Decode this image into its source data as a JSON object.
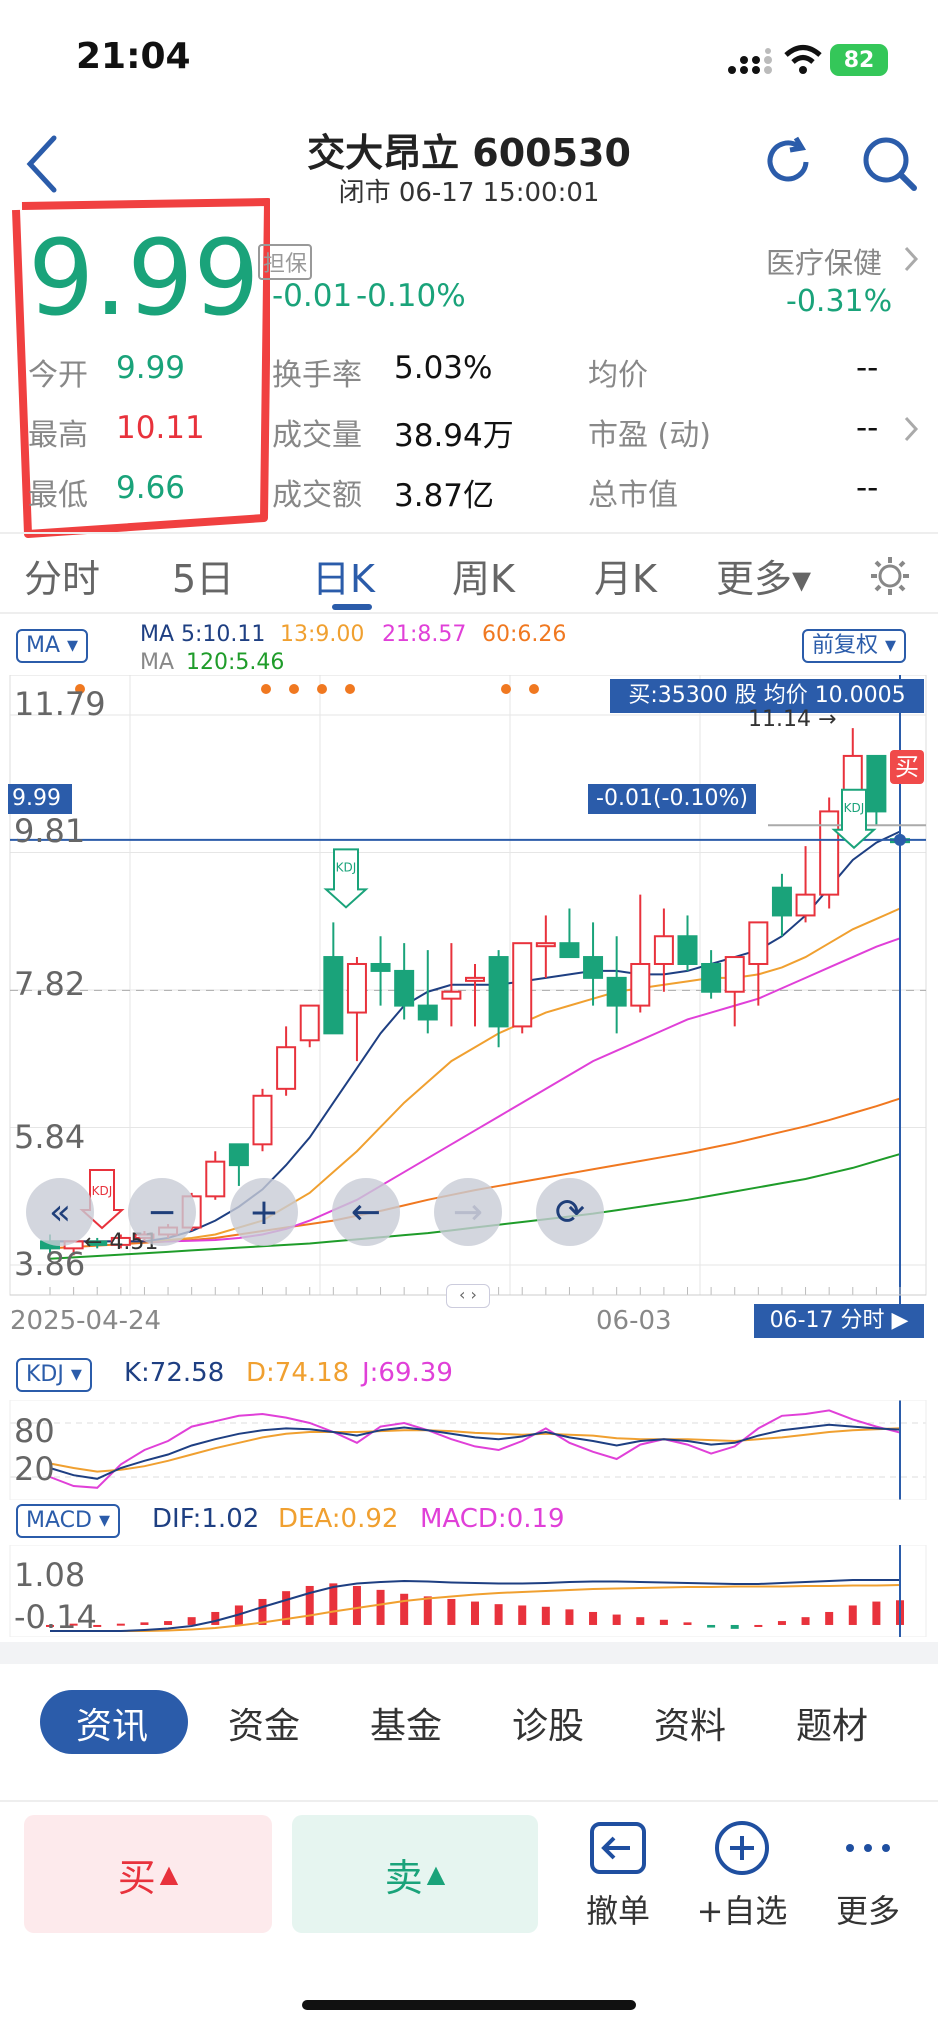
{
  "status_bar": {
    "time": "21:04",
    "battery": "82"
  },
  "header": {
    "title": "交大昂立 600530",
    "subtitle": "闭市 06-17 15:00:01"
  },
  "quote": {
    "price": "9.99",
    "margin_tag": "担保",
    "change": "-0.01",
    "change_pct": "-0.10%",
    "sector": "医疗保健",
    "sector_pct": "-0.31%",
    "open_label": "今开",
    "open": "9.99",
    "high_label": "最高",
    "high": "10.11",
    "low_label": "最低",
    "low": "9.66",
    "turnover_label": "换手率",
    "turnover": "5.03%",
    "volume_label": "成交量",
    "volume": "38.94万",
    "amount_label": "成交额",
    "amount": "3.87亿",
    "avg_label": "均价",
    "avg": "--",
    "pe_label": "市盈 (动)",
    "pe": "--",
    "mcap_label": "总市值",
    "mcap": "--"
  },
  "tabs": [
    "分时",
    "5日",
    "日K",
    "周K",
    "月K",
    "更多▾"
  ],
  "active_tab": "日K",
  "ma_bar": {
    "selector": "MA ▾",
    "ma5": "MA 5:10.11",
    "ma13": "13:9.00",
    "ma21": "21:8.57",
    "ma60": "60:6.26",
    "ma120_prefix": "MA",
    "ma120": "120:5.46",
    "adjust": "前复权 ▾"
  },
  "colors": {
    "up": "#e8323c",
    "down": "#1aa37a",
    "ma5": "#1e3f82",
    "ma13": "#f0a030",
    "ma21": "#e040d8",
    "ma60": "#f07820",
    "ma120": "#1f9c2a",
    "accent": "#2b5caa"
  },
  "chart": {
    "price_ticks": [
      "11.79",
      "9.81",
      "7.82",
      "5.84",
      "3.86"
    ],
    "last_price_tag": "9.99",
    "crosshair_change": "-0.01(-0.10%)",
    "tooltip": "买:35300 股 均价 10.0005",
    "max_label": "11.14",
    "min_label": "4.51",
    "buy_marker": "买",
    "kdj_marker": "KDJ",
    "date_start": "2025-04-24",
    "date_mid": "06-03",
    "date_tag": "06-17 分时"
  },
  "kdj": {
    "selector": "KDJ ▾",
    "k": "K:72.58",
    "d": "D:74.18",
    "j": "J:69.39",
    "ticks": [
      "80",
      "20"
    ]
  },
  "macd": {
    "selector": "MACD ▾",
    "dif": "DIF:1.02",
    "dea": "DEA:0.92",
    "macd": "MACD:0.19",
    "ticks": [
      "1.08",
      "-0.14"
    ]
  },
  "chart_data": {
    "type": "candlestick",
    "candles": [
      [
        4.2,
        4.3,
        4.0,
        4.1
      ],
      [
        4.1,
        4.2,
        4.0,
        4.2
      ],
      [
        4.2,
        4.25,
        4.1,
        4.15
      ],
      [
        4.15,
        4.3,
        4.1,
        4.25
      ],
      [
        4.25,
        4.35,
        4.2,
        4.3
      ],
      [
        4.3,
        4.45,
        4.25,
        4.4
      ],
      [
        4.4,
        4.9,
        4.35,
        4.85
      ],
      [
        4.85,
        5.5,
        4.8,
        5.35
      ],
      [
        5.6,
        5.5,
        5.0,
        5.3
      ],
      [
        5.6,
        6.4,
        5.5,
        6.3
      ],
      [
        6.4,
        7.3,
        6.3,
        7.0
      ],
      [
        7.1,
        7.6,
        7.0,
        7.6
      ],
      [
        8.3,
        8.8,
        7.2,
        7.2
      ],
      [
        7.5,
        8.3,
        6.8,
        8.2
      ],
      [
        8.2,
        8.6,
        7.6,
        8.1
      ],
      [
        8.1,
        8.5,
        7.4,
        7.6
      ],
      [
        7.6,
        8.4,
        7.2,
        7.4
      ],
      [
        7.7,
        8.5,
        7.3,
        7.8
      ],
      [
        8.0,
        8.2,
        7.3,
        8.0
      ],
      [
        8.3,
        8.4,
        7.0,
        7.3
      ],
      [
        7.3,
        8.5,
        7.2,
        8.5
      ],
      [
        8.5,
        8.9,
        8.0,
        8.5
      ],
      [
        8.5,
        9.0,
        8.3,
        8.3
      ],
      [
        8.3,
        8.8,
        7.6,
        8.0
      ],
      [
        8.0,
        8.6,
        7.2,
        7.6
      ],
      [
        7.6,
        9.2,
        7.5,
        8.2
      ],
      [
        8.2,
        9.0,
        7.8,
        8.6
      ],
      [
        8.6,
        8.9,
        8.1,
        8.2
      ],
      [
        8.2,
        8.4,
        7.7,
        7.8
      ],
      [
        7.8,
        8.3,
        7.3,
        8.3
      ],
      [
        8.2,
        8.8,
        7.6,
        8.8
      ],
      [
        9.3,
        9.5,
        8.6,
        8.9
      ],
      [
        8.9,
        9.9,
        8.8,
        9.2
      ],
      [
        9.2,
        10.6,
        9.0,
        10.4
      ],
      [
        10.4,
        11.6,
        10.1,
        11.2
      ],
      [
        11.2,
        11.14,
        10.2,
        10.4
      ],
      [
        10.0,
        10.11,
        9.66,
        9.99
      ]
    ],
    "ma5": [
      4.2,
      4.2,
      4.2,
      4.2,
      4.2,
      4.25,
      4.35,
      4.5,
      4.7,
      4.95,
      5.3,
      5.7,
      6.2,
      6.7,
      7.2,
      7.6,
      7.8,
      7.9,
      7.9,
      7.9,
      7.95,
      8.0,
      8.05,
      8.1,
      8.1,
      8.05,
      8.05,
      8.1,
      8.2,
      8.3,
      8.4,
      8.6,
      8.9,
      9.3,
      9.7,
      9.95,
      10.11
    ],
    "ma13": [
      4.2,
      4.2,
      4.2,
      4.2,
      4.2,
      4.22,
      4.25,
      4.3,
      4.4,
      4.5,
      4.7,
      4.9,
      5.2,
      5.5,
      5.85,
      6.2,
      6.5,
      6.8,
      7.0,
      7.2,
      7.35,
      7.5,
      7.6,
      7.7,
      7.8,
      7.85,
      7.9,
      7.95,
      8.0,
      8.0,
      8.05,
      8.15,
      8.3,
      8.5,
      8.7,
      8.85,
      9.0
    ],
    "ma21": [
      4.2,
      4.2,
      4.2,
      4.2,
      4.2,
      4.2,
      4.21,
      4.22,
      4.25,
      4.3,
      4.38,
      4.5,
      4.65,
      4.8,
      5.0,
      5.2,
      5.4,
      5.6,
      5.8,
      6.0,
      6.2,
      6.4,
      6.6,
      6.8,
      6.95,
      7.1,
      7.25,
      7.4,
      7.5,
      7.6,
      7.7,
      7.85,
      8.0,
      8.15,
      8.3,
      8.45,
      8.57
    ],
    "ma60": [
      4.1,
      4.12,
      4.14,
      4.16,
      4.18,
      4.2,
      4.22,
      4.25,
      4.3,
      4.35,
      4.4,
      4.45,
      4.5,
      4.57,
      4.64,
      4.72,
      4.8,
      4.87,
      4.94,
      5.0,
      5.06,
      5.12,
      5.18,
      5.24,
      5.3,
      5.36,
      5.42,
      5.48,
      5.55,
      5.62,
      5.7,
      5.78,
      5.86,
      5.95,
      6.05,
      6.15,
      6.26
    ],
    "ma120": [
      3.95,
      3.97,
      3.99,
      4.01,
      4.03,
      4.05,
      4.07,
      4.09,
      4.11,
      4.13,
      4.15,
      4.17,
      4.2,
      4.23,
      4.26,
      4.29,
      4.32,
      4.36,
      4.4,
      4.44,
      4.48,
      4.52,
      4.56,
      4.6,
      4.65,
      4.7,
      4.75,
      4.8,
      4.86,
      4.92,
      4.98,
      5.04,
      5.1,
      5.18,
      5.26,
      5.36,
      5.46
    ],
    "macd_bars": [
      0.0,
      0.01,
      0.0,
      0.01,
      0.02,
      0.03,
      0.06,
      0.1,
      0.15,
      0.2,
      0.26,
      0.3,
      0.32,
      0.3,
      0.27,
      0.24,
      0.22,
      0.2,
      0.18,
      0.16,
      0.15,
      0.14,
      0.12,
      0.1,
      0.08,
      0.06,
      0.04,
      0.02,
      -0.02,
      -0.03,
      0.0,
      0.03,
      0.06,
      0.1,
      0.15,
      0.18,
      0.19
    ],
    "dif": [
      0.0,
      0.0,
      0.0,
      0.0,
      0.02,
      0.05,
      0.1,
      0.2,
      0.33,
      0.48,
      0.62,
      0.76,
      0.88,
      0.95,
      0.98,
      1.0,
      0.99,
      0.97,
      0.96,
      0.95,
      0.95,
      0.96,
      0.98,
      0.99,
      0.99,
      0.98,
      0.97,
      0.96,
      0.95,
      0.94,
      0.94,
      0.96,
      0.98,
      1.0,
      1.02,
      1.02,
      1.02
    ],
    "dea": [
      0.0,
      0.0,
      0.0,
      0.0,
      0.0,
      0.01,
      0.03,
      0.06,
      0.11,
      0.17,
      0.24,
      0.31,
      0.39,
      0.46,
      0.53,
      0.6,
      0.65,
      0.69,
      0.73,
      0.76,
      0.78,
      0.8,
      0.82,
      0.84,
      0.85,
      0.86,
      0.87,
      0.88,
      0.88,
      0.89,
      0.89,
      0.89,
      0.9,
      0.9,
      0.91,
      0.91,
      0.92
    ],
    "kdj_k": [
      30,
      22,
      18,
      30,
      38,
      45,
      55,
      62,
      68,
      72,
      74,
      73,
      70,
      66,
      72,
      75,
      72,
      68,
      64,
      62,
      65,
      70,
      64,
      60,
      55,
      60,
      62,
      60,
      56,
      58,
      66,
      72,
      75,
      78,
      76,
      74,
      72.58
    ],
    "kdj_d": [
      35,
      30,
      26,
      28,
      32,
      38,
      45,
      52,
      58,
      64,
      68,
      70,
      70,
      70,
      71,
      72,
      72,
      71,
      69,
      68,
      67,
      68,
      67,
      66,
      63,
      62,
      62,
      62,
      61,
      60,
      62,
      64,
      67,
      70,
      72,
      73,
      74.18
    ],
    "kdj_j": [
      20,
      10,
      8,
      34,
      50,
      60,
      76,
      82,
      88,
      90,
      86,
      80,
      70,
      58,
      76,
      80,
      72,
      62,
      54,
      50,
      60,
      74,
      58,
      48,
      40,
      56,
      62,
      56,
      46,
      54,
      74,
      88,
      90,
      94,
      84,
      76,
      69.39
    ]
  },
  "news_tabs": [
    "资讯",
    "资金",
    "基金",
    "诊股",
    "资料",
    "题材"
  ],
  "bottom": {
    "buy": "买",
    "sell": "卖",
    "cancel": "撤单",
    "watch": "+自选",
    "more": "更多"
  }
}
